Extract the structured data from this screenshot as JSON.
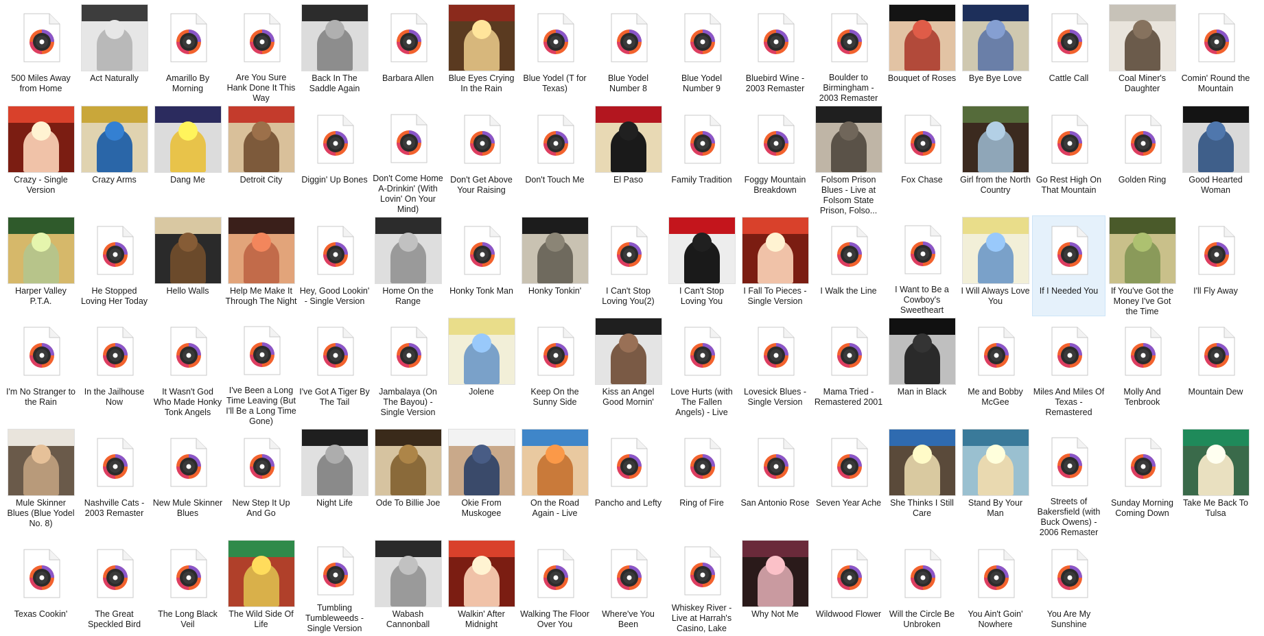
{
  "icons": {
    "file": "music-file-icon",
    "art": "album-art-thumbnail"
  },
  "colors": {
    "selection": "#e5f1fb",
    "selection_border": "#cce4f7",
    "disc_orange": "#f2622e",
    "disc_purple": "#8a56c9"
  },
  "files": [
    {
      "name": "500 Miles Away from Home",
      "art": false
    },
    {
      "name": "Act Naturally",
      "art": true,
      "c1": "#3d3d3d",
      "c2": "#b9b9b9",
      "c3": "#e6e6e6"
    },
    {
      "name": "Amarillo By Morning",
      "art": false
    },
    {
      "name": "Are You Sure Hank Done It This Way",
      "art": false
    },
    {
      "name": "Back In The Saddle Again",
      "art": true,
      "c1": "#2c2c2c",
      "c2": "#8d8d8d",
      "c3": "#dcdcdc"
    },
    {
      "name": "Barbara Allen",
      "art": false
    },
    {
      "name": "Blue Eyes Crying In the Rain",
      "art": true,
      "c1": "#8b2a1c",
      "c2": "#d7b77c",
      "c3": "#5a3a20"
    },
    {
      "name": "Blue Yodel (T for Texas)",
      "art": false
    },
    {
      "name": "Blue Yodel Number 8",
      "art": false
    },
    {
      "name": "Blue Yodel Number 9",
      "art": false
    },
    {
      "name": "Bluebird Wine - 2003 Remaster",
      "art": false
    },
    {
      "name": "Boulder to Birmingham - 2003 Remaster",
      "art": false
    },
    {
      "name": "Bouquet of Roses",
      "art": true,
      "c1": "#141414",
      "c2": "#b24a3a",
      "c3": "#e2c3a4"
    },
    {
      "name": "Bye Bye Love",
      "art": true,
      "c1": "#1d2f5a",
      "c2": "#6a7fa8",
      "c3": "#cfc8b0"
    },
    {
      "name": "Cattle Call",
      "art": false
    },
    {
      "name": "Coal Miner's Daughter",
      "art": true,
      "c1": "#c7c2b8",
      "c2": "#6b5b4b",
      "c3": "#e9e4dc"
    },
    {
      "name": "Comin' Round the Mountain",
      "art": false
    },
    {
      "name": "Crazy - Single Version",
      "art": true,
      "c1": "#d9412b",
      "c2": "#f0c2a8",
      "c3": "#7b1d12"
    },
    {
      "name": "Crazy Arms",
      "art": true,
      "c1": "#c9a73a",
      "c2": "#2a66a8",
      "c3": "#e0d3b0"
    },
    {
      "name": "Dang Me",
      "art": true,
      "c1": "#2b2b5e",
      "c2": "#e8c34a",
      "c3": "#dcdcdc"
    },
    {
      "name": "Detroit City",
      "art": true,
      "c1": "#c43b2c",
      "c2": "#7d5a3b",
      "c3": "#d9c09a"
    },
    {
      "name": "Diggin' Up Bones",
      "art": false
    },
    {
      "name": "Don't Come Home A-Drinkin' (With Lovin' On Your Mind)",
      "art": false
    },
    {
      "name": "Don't Get Above Your Raising",
      "art": false
    },
    {
      "name": "Don't Touch Me",
      "art": false
    },
    {
      "name": "El Paso",
      "art": true,
      "c1": "#b3161f",
      "c2": "#1a1a1a",
      "c3": "#e8d9b4"
    },
    {
      "name": "Family Tradition",
      "art": false
    },
    {
      "name": "Foggy Mountain Breakdown",
      "art": false
    },
    {
      "name": "Folsom Prison Blues - Live at Folsom State Prison, Folso...",
      "art": true,
      "c1": "#1f1f1f",
      "c2": "#5a5248",
      "c3": "#bfb5a6"
    },
    {
      "name": "Fox Chase",
      "art": false
    },
    {
      "name": "Girl from the North Country",
      "art": true,
      "c1": "#556b3a",
      "c2": "#8fa6b8",
      "c3": "#3b2a1f"
    },
    {
      "name": "Go Rest High On That Mountain",
      "art": false
    },
    {
      "name": "Golden Ring",
      "art": false
    },
    {
      "name": "Good Hearted Woman",
      "art": true,
      "c1": "#141414",
      "c2": "#3f5f8a",
      "c3": "#d9d9d9"
    },
    {
      "name": "Harper Valley P.T.A.",
      "art": true,
      "c1": "#2f5a2b",
      "c2": "#b7c48a",
      "c3": "#d6b86a"
    },
    {
      "name": "He Stopped Loving Her Today",
      "art": false
    },
    {
      "name": "Hello Walls",
      "art": true,
      "c1": "#d9c8a2",
      "c2": "#6b4a2b",
      "c3": "#2a2a2a"
    },
    {
      "name": "Help Me Make It Through The Night",
      "art": true,
      "c1": "#3a1f1a",
      "c2": "#c26b4a",
      "c3": "#e2a47a"
    },
    {
      "name": "Hey, Good Lookin' - Single Version",
      "art": false
    },
    {
      "name": "Home On the Range",
      "art": true,
      "c1": "#2c2c2c",
      "c2": "#9a9a9a",
      "c3": "#dedede"
    },
    {
      "name": "Honky Tonk Man",
      "art": false
    },
    {
      "name": "Honky Tonkin'",
      "art": true,
      "c1": "#1c1c1c",
      "c2": "#6f6a5e",
      "c3": "#c9c2b2"
    },
    {
      "name": "I Can't Stop Loving You(2)",
      "art": false
    },
    {
      "name": "I Can't Stop Loving You",
      "art": true,
      "c1": "#c4151c",
      "c2": "#1a1a1a",
      "c3": "#ededed"
    },
    {
      "name": "I Fall To Pieces - Single Version",
      "art": true,
      "c1": "#d9412b",
      "c2": "#f0c2a8",
      "c3": "#7b1d12"
    },
    {
      "name": "I Walk the Line",
      "art": false
    },
    {
      "name": "I Want to Be a Cowboy's Sweetheart",
      "art": false
    },
    {
      "name": "I Will Always Love You",
      "art": true,
      "c1": "#e9dd8a",
      "c2": "#7aa1c9",
      "c3": "#f2efd8"
    },
    {
      "name": "If I Needed You",
      "art": false,
      "selected": true
    },
    {
      "name": "If You've Got the Money I've Got the Time",
      "art": true,
      "c1": "#4a5a2a",
      "c2": "#8a9a5a",
      "c3": "#c9c08a"
    },
    {
      "name": "I'll Fly Away",
      "art": false
    },
    {
      "name": "I'm No Stranger to the Rain",
      "art": false
    },
    {
      "name": "In the Jailhouse Now",
      "art": false
    },
    {
      "name": "It Wasn't God Who Made Honky Tonk Angels",
      "art": false
    },
    {
      "name": "I've Been a Long Time Leaving (But I'll Be a Long Time Gone)",
      "art": false
    },
    {
      "name": "I've Got A Tiger By The Tail",
      "art": false
    },
    {
      "name": "Jambalaya (On The Bayou) - Single Version",
      "art": false
    },
    {
      "name": "Jolene",
      "art": true,
      "c1": "#e9dd8a",
      "c2": "#7aa1c9",
      "c3": "#f2efd8"
    },
    {
      "name": "Keep On the Sunny Side",
      "art": false
    },
    {
      "name": "Kiss an Angel Good Mornin'",
      "art": true,
      "c1": "#1f1f1f",
      "c2": "#7a5a45",
      "c3": "#e4e4e4"
    },
    {
      "name": "Love Hurts (with The Fallen Angels) - Live",
      "art": false
    },
    {
      "name": "Lovesick Blues - Single Version",
      "art": false
    },
    {
      "name": "Mama Tried - Remastered 2001",
      "art": false
    },
    {
      "name": "Man in Black",
      "art": true,
      "c1": "#111111",
      "c2": "#2a2a2a",
      "c3": "#bfbfbf"
    },
    {
      "name": "Me and Bobby McGee",
      "art": false
    },
    {
      "name": "Miles And Miles Of Texas - Remastered",
      "art": false
    },
    {
      "name": "Molly And Tenbrook",
      "art": false
    },
    {
      "name": "Mountain Dew",
      "art": false
    },
    {
      "name": "Mule Skinner Blues (Blue Yodel No. 8)",
      "art": true,
      "c1": "#e9e4dc",
      "c2": "#b89a7a",
      "c3": "#6a5a4a"
    },
    {
      "name": "Nashville Cats - 2003 Remaster",
      "art": false
    },
    {
      "name": "New Mule Skinner Blues",
      "art": false
    },
    {
      "name": "New Step It Up And Go",
      "art": false
    },
    {
      "name": "Night Life",
      "art": true,
      "c1": "#1f1f1f",
      "c2": "#8a8a8a",
      "c3": "#e0e0e0"
    },
    {
      "name": "Ode To Billie Joe",
      "art": true,
      "c1": "#3a2a1a",
      "c2": "#8a6a3a",
      "c3": "#d6c3a0"
    },
    {
      "name": "Okie From Muskogee",
      "art": true,
      "c1": "#f2f2f2",
      "c2": "#3a4a6a",
      "c3": "#c9a98a"
    },
    {
      "name": "On the Road Again - Live",
      "art": true,
      "c1": "#3f86c9",
      "c2": "#c97a3a",
      "c3": "#e9c9a0"
    },
    {
      "name": "Pancho and Lefty",
      "art": false
    },
    {
      "name": "Ring of Fire",
      "art": false
    },
    {
      "name": "San Antonio Rose",
      "art": false
    },
    {
      "name": "Seven Year Ache",
      "art": false
    },
    {
      "name": "She Thinks I Still Care",
      "art": true,
      "c1": "#2f6bb0",
      "c2": "#d9c9a0",
      "c3": "#5a4a3a"
    },
    {
      "name": "Stand By Your Man",
      "art": true,
      "c1": "#3a7a9a",
      "c2": "#e9d9b0",
      "c3": "#9ac0d0"
    },
    {
      "name": "Streets of Bakersfield (with Buck Owens) - 2006 Remaster",
      "art": false
    },
    {
      "name": "Sunday Morning Coming Down",
      "art": false
    },
    {
      "name": "Take Me Back To Tulsa",
      "art": true,
      "c1": "#1f8a5a",
      "c2": "#e9e0c0",
      "c3": "#3a6a4a"
    },
    {
      "name": "Texas Cookin'",
      "art": false
    },
    {
      "name": "The Great Speckled Bird",
      "art": false
    },
    {
      "name": "The Long Black Veil",
      "art": false
    },
    {
      "name": "The Wild Side Of Life",
      "art": true,
      "c1": "#2f8a4a",
      "c2": "#d9b04a",
      "c3": "#b0402a"
    },
    {
      "name": "Tumbling Tumbleweeds - Single Version",
      "art": false
    },
    {
      "name": "Wabash Cannonball",
      "art": true,
      "c1": "#2a2a2a",
      "c2": "#9a9a9a",
      "c3": "#dedede"
    },
    {
      "name": "Walkin' After Midnight",
      "art": true,
      "c1": "#d9412b",
      "c2": "#f0c2a8",
      "c3": "#7b1d12"
    },
    {
      "name": "Walking The Floor Over You",
      "art": false
    },
    {
      "name": "Where've You Been",
      "art": false
    },
    {
      "name": "Whiskey River - Live at Harrah's Casino, Lake",
      "art": false
    },
    {
      "name": "Why Not Me",
      "art": true,
      "c1": "#6a2a3a",
      "c2": "#c99aa0",
      "c3": "#2a1a1a"
    },
    {
      "name": "Wildwood Flower",
      "art": false
    },
    {
      "name": "Will the Circle Be Unbroken",
      "art": false
    },
    {
      "name": "You Ain't Goin' Nowhere",
      "art": false
    },
    {
      "name": "You Are My Sunshine",
      "art": false
    }
  ]
}
